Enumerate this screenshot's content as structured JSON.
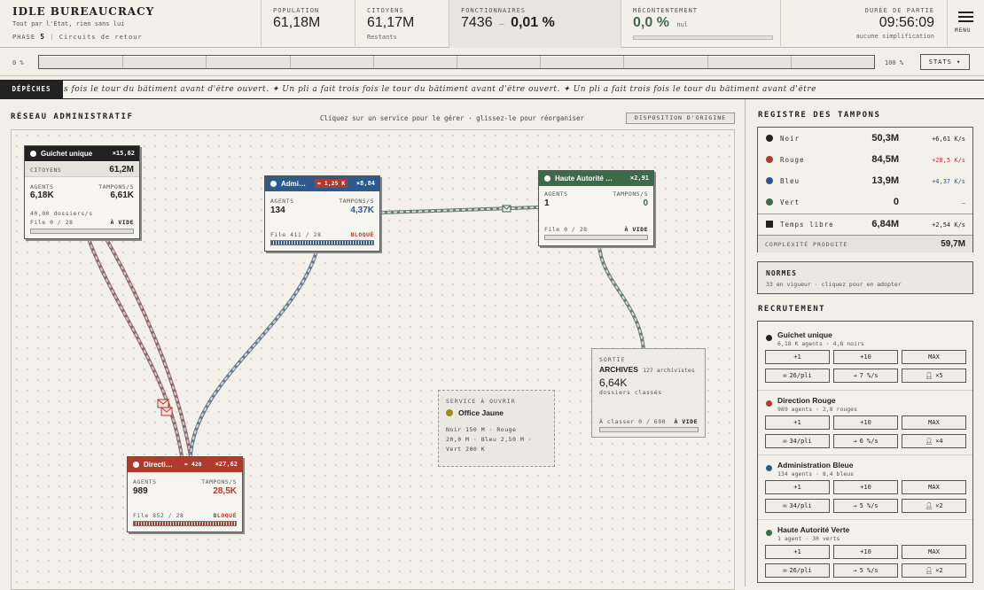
{
  "app": {
    "title": "IDLE BUREAUCRACY",
    "motto": "Tout par l'État, rien sans lui",
    "phase_label": "PHASE",
    "phase_num": "5",
    "phase_name": "Circuits de retour"
  },
  "header": {
    "population": {
      "label": "POPULATION",
      "value": "61,18M"
    },
    "citoyens": {
      "label": "CITOYENS",
      "value": "61,17M",
      "sub": "Restants"
    },
    "fonctionnaires": {
      "label": "FONCTIONNAIRES",
      "value": "7436",
      "sep": "–",
      "pct": "0,01 %"
    },
    "mecontentement": {
      "label": "MÉCONTENTEMENT",
      "value": "0,0 %",
      "sub": "nul",
      "level": 0
    },
    "duree": {
      "label": "DURÉE DE PARTIE",
      "value": "09:56:09",
      "sub": "aucune simplification"
    },
    "menu_label": "MENU"
  },
  "progress": {
    "left": "0 %",
    "right": "100 %",
    "value": 0,
    "stats_label": "STATS ▾"
  },
  "ticker": {
    "label": "DÉPÊCHES",
    "text": "s fois le tour du bâtiment avant d'être ouvert.  ✦  Un pli a fait trois fois le tour du bâtiment avant d'être ouvert.  ✦  Un pli a fait trois fois le tour du bâtiment avant d'être"
  },
  "network": {
    "title": "RÉSEAU ADMINISTRATIF",
    "hint": "Cliquez sur un service pour le gérer · glissez-le pour réorganiser",
    "reset_label": "DISPOSITION D'ORIGINE",
    "guichet": {
      "name": "Guichet unique",
      "mult": "×15,62",
      "citizens_label": "CITOYENS",
      "citizens": "61,2M",
      "agents_label": "AGENTS",
      "agents": "6,18K",
      "tampons_label": "TAMPONS/S",
      "tampons": "6,61K",
      "rate": "40,00 dossiers/s",
      "file": "File 0 / 28",
      "status": "À VIDE",
      "fill": 0
    },
    "admin": {
      "name": "Admi…",
      "badge": "≈ 1,25 K",
      "mult": "×8,84",
      "agents_label": "AGENTS",
      "agents": "134",
      "tampons_label": "TAMPONS/S",
      "tampons": "4,37K",
      "file": "File 411 / 28",
      "status": "BLOQUÉ",
      "fill": 1
    },
    "haute": {
      "name": "Haute Autorité …",
      "mult": "×2,91",
      "agents_label": "AGENTS",
      "agents": "1",
      "tampons_label": "TAMPONS/S",
      "tampons": "0",
      "file": "File 0 / 28",
      "status": "À VIDE",
      "fill": 0
    },
    "direction": {
      "name": "Directi…",
      "badge": "≈ 420",
      "mult": "×27,62",
      "agents_label": "AGENTS",
      "agents": "989",
      "tampons_label": "TAMPONS/S",
      "tampons": "28,5K",
      "file": "File 852 / 28",
      "status": "BLOQUÉ",
      "fill": 1
    },
    "sortie": {
      "label": "SORTIE",
      "name": "ARCHIVES",
      "archivists": "127 archivistes",
      "value": "6,64K",
      "sub": "dossiers classés",
      "file": "À classer 0 / 690",
      "status": "À VIDE",
      "fill": 0
    },
    "ouvrir": {
      "label": "SERVICE À OUVRIR",
      "name": "Office Jaune",
      "line1": "Noir 150 M · Rouge",
      "line2": "20,0 M · Bleu 2,50 M ·",
      "line3": "Vert 200 K"
    }
  },
  "registre": {
    "title": "REGISTRE DES TAMPONS",
    "rows": [
      {
        "name": "Noir",
        "value": "50,3M",
        "rate": "+6,61 K/s",
        "color": "#222222",
        "rate_color": "#222222"
      },
      {
        "name": "Rouge",
        "value": "84,5M",
        "rate": "+28,5 K/s",
        "color": "#b03a2e",
        "rate_color": "#b03a2e"
      },
      {
        "name": "Bleu",
        "value": "13,9M",
        "rate": "+4,37 K/s",
        "color": "#2d5a8e",
        "rate_color": "#2d5a8e"
      },
      {
        "name": "Vert",
        "value": "0",
        "rate": "–",
        "color": "#3d6b4a",
        "rate_color": "#555555"
      },
      {
        "name": "Temps libre",
        "value": "6,84M",
        "rate": "+2,54 K/s",
        "color": "#222222",
        "rate_color": "#222222"
      }
    ],
    "complexite_label": "COMPLEXITÉ PRODUITE",
    "complexite": "59,7M"
  },
  "normes": {
    "title": "NORMES",
    "sub": "33 en vigueur · cliquez pour en adopter"
  },
  "recrutement": {
    "title": "RECRUTEMENT",
    "items": [
      {
        "name": "Guichet unique",
        "sub": "6,18 K agents · 4,8 noirs",
        "color": "#222222",
        "b1": "+1",
        "b2": "+10",
        "b3": "MAX",
        "c1": "26/pli",
        "c2": "7 %/s",
        "c3": "×5"
      },
      {
        "name": "Direction Rouge",
        "sub": "989 agents · 2,8 rouges",
        "color": "#b03a2e",
        "b1": "+1",
        "b2": "+10",
        "b3": "MAX",
        "c1": "34/pli",
        "c2": "6 %/s",
        "c3": "×4"
      },
      {
        "name": "Administration Bleue",
        "sub": "134 agents · 8,4 bleus",
        "color": "#2d5a8e",
        "b1": "+1",
        "b2": "+10",
        "b3": "MAX",
        "c1": "34/pli",
        "c2": "5 %/s",
        "c3": "×2"
      },
      {
        "name": "Haute Autorité Verte",
        "sub": "1 agent · 30 verts",
        "color": "#3d6b4a",
        "b1": "+1",
        "b2": "+10",
        "b3": "MAX",
        "c1": "26/pli",
        "c2": "5 %/s",
        "c3": "×2"
      }
    ]
  },
  "colors": {
    "noir": "#222222",
    "rouge": "#b03a2e",
    "bleu": "#2d5a8e",
    "vert": "#3d6b4a",
    "jaune": "#a8861e"
  }
}
